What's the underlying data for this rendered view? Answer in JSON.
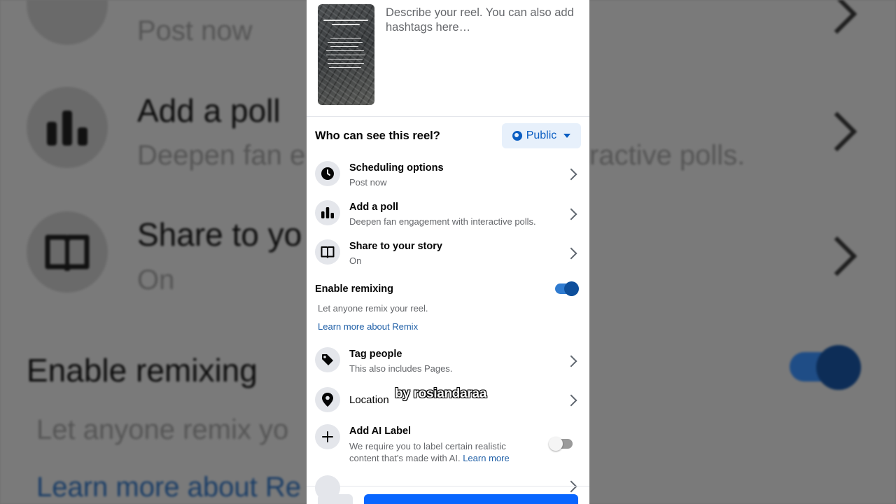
{
  "background": {
    "post_now": "Post now",
    "add_poll": "Add a poll",
    "deepen_left": "Deepen fan e",
    "deepen_right": "ractive polls.",
    "share_partial": "Share to yo",
    "on": "On",
    "enable_remixing": "Enable remixing",
    "let_anyone_partial": "Let anyone remix yo",
    "learn_more_partial": "Learn more about Re"
  },
  "composer": {
    "description_placeholder": "Describe your reel. You can also add hashtags here…"
  },
  "audience": {
    "question": "Who can see this reel?",
    "button_label": "Public",
    "button_icon": "globe-icon"
  },
  "options": [
    {
      "title": "Scheduling options",
      "subtitle": "Post now",
      "icon": "clock-icon"
    },
    {
      "title": "Add a poll",
      "subtitle": "Deepen fan engagement with interactive polls.",
      "icon": "poll-icon"
    },
    {
      "title": "Share to your story",
      "subtitle": "On",
      "icon": "book-icon"
    }
  ],
  "remix": {
    "title": "Enable remixing",
    "description": "Let anyone remix your reel.",
    "link": "Learn more about Remix",
    "enabled": true
  },
  "options2": [
    {
      "title": "Tag people",
      "subtitle": "This also includes Pages.",
      "icon": "tag-icon"
    },
    {
      "title": "Location",
      "icon": "location-pin-icon"
    }
  ],
  "ai_label": {
    "title": "Add AI Label",
    "description": "We require you to label certain realistic content that's made with AI.",
    "link": "Learn more",
    "enabled": false,
    "icon": "plus-icon"
  },
  "watermark": "by rosiandaraa",
  "colors": {
    "accent": "#0866ff",
    "link": "#1f5fa7",
    "toggle_on": "#2f7bd0"
  }
}
